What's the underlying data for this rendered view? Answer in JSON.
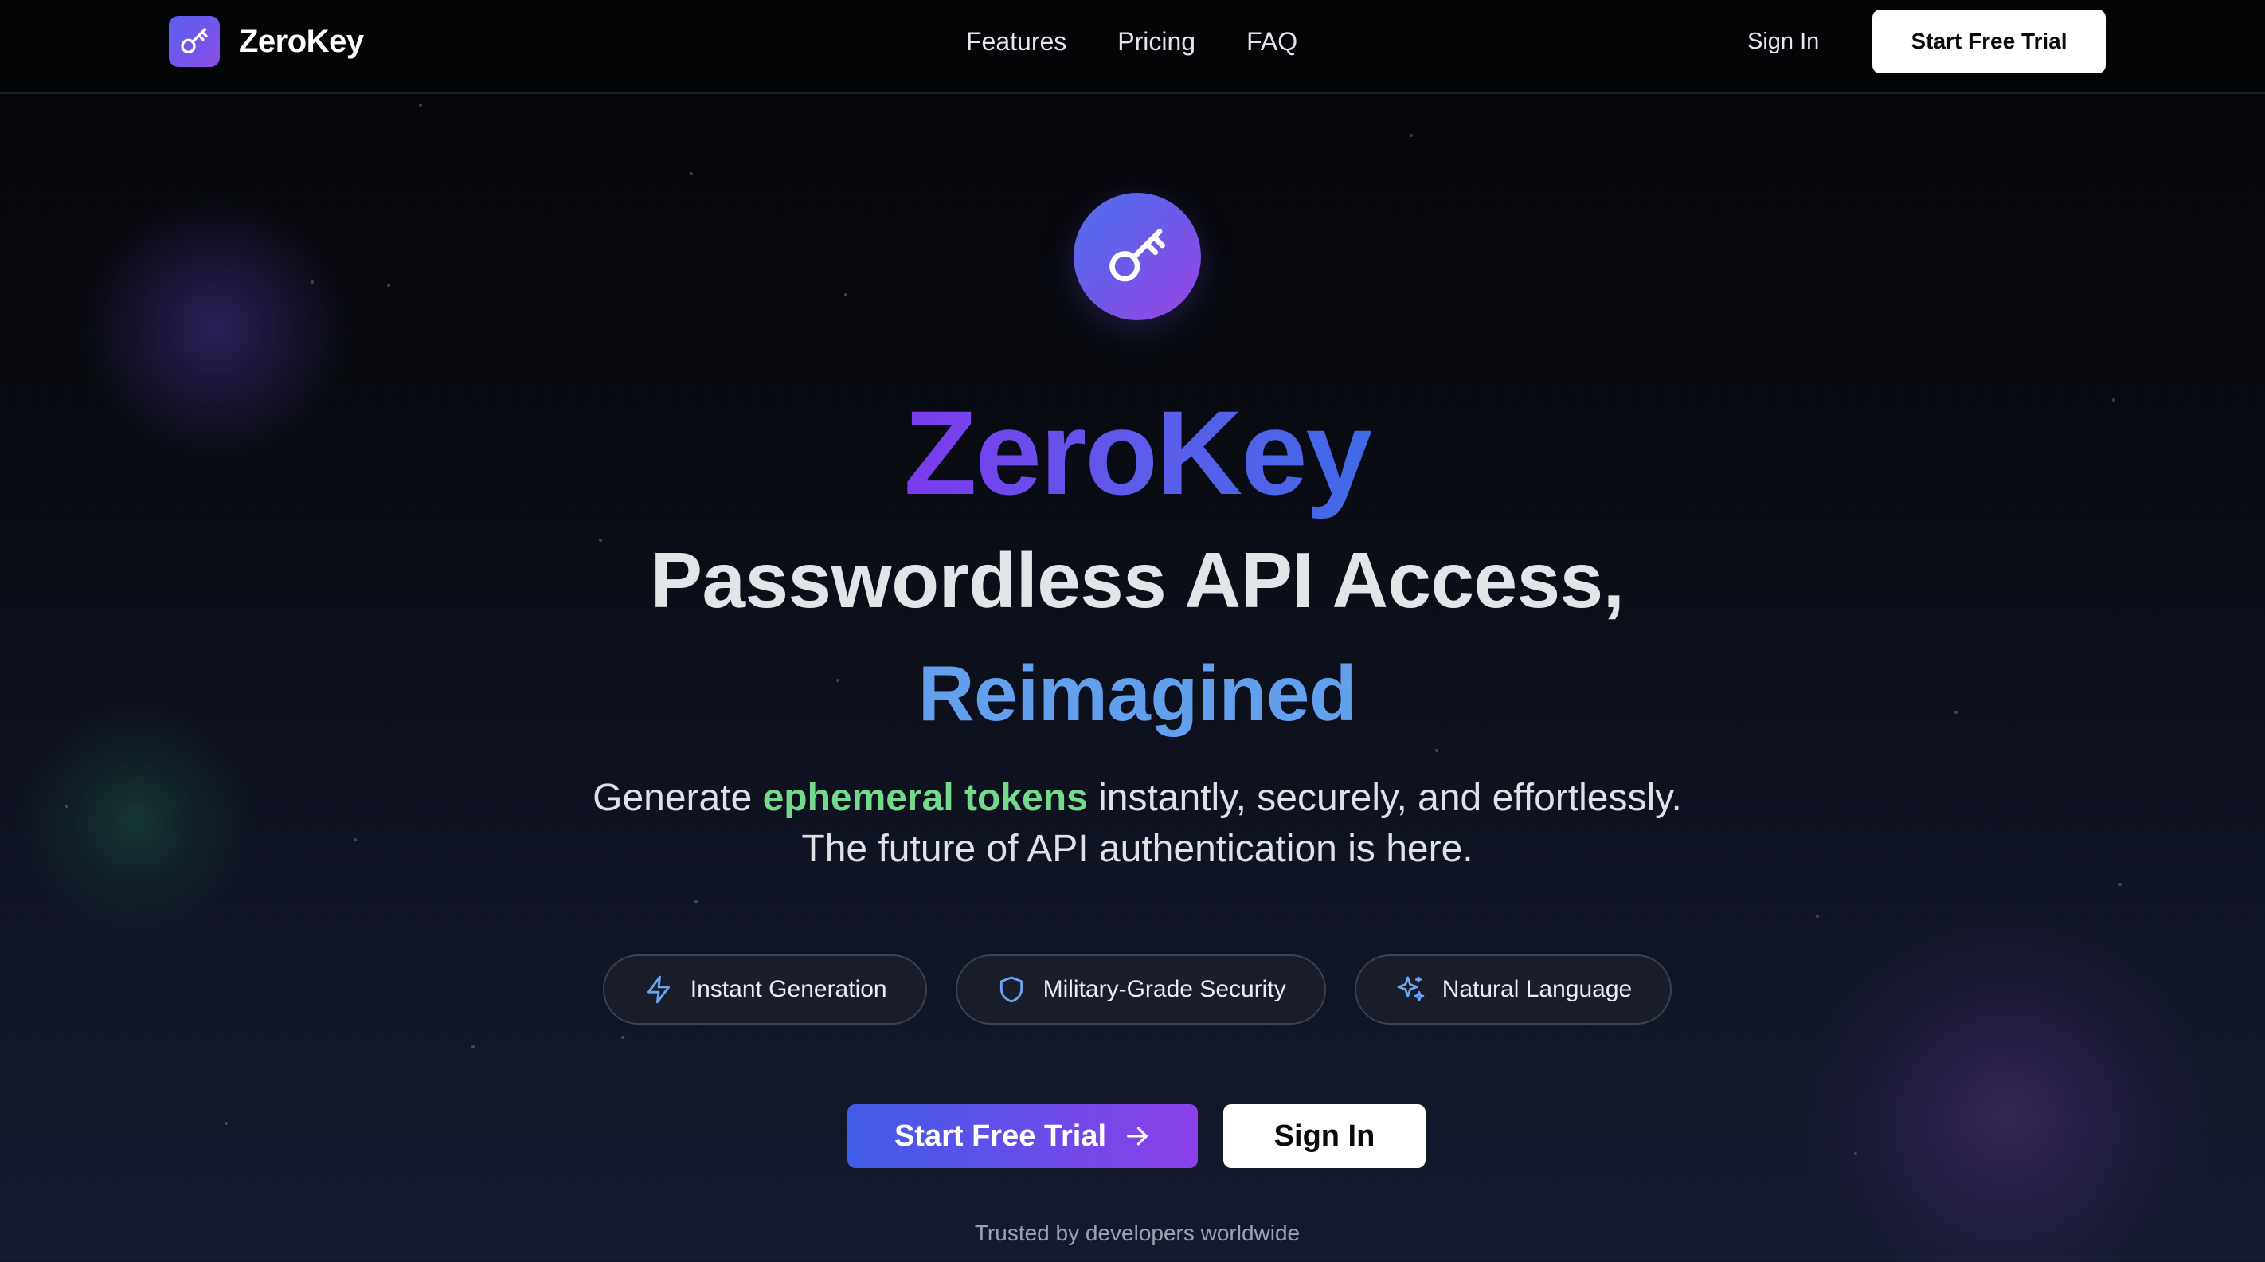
{
  "nav": {
    "brand": "ZeroKey",
    "links": [
      "Features",
      "Pricing",
      "FAQ"
    ],
    "sign_in": "Sign In",
    "start_trial": "Start Free Trial"
  },
  "hero": {
    "title": "ZeroKey",
    "subtitle_line1": "Passwordless API Access,",
    "subtitle_line2": "Reimagined",
    "desc_pre": "Generate ",
    "desc_highlight": "ephemeral tokens",
    "desc_post": " instantly, securely, and effortlessly.",
    "desc_line2": "The future of API authentication is here."
  },
  "features": [
    {
      "label": "Instant Generation",
      "icon": "lightning-icon"
    },
    {
      "label": "Military-Grade Security",
      "icon": "shield-icon"
    },
    {
      "label": "Natural Language",
      "icon": "sparkles-icon"
    }
  ],
  "cta": {
    "primary": "Start Free Trial",
    "secondary": "Sign In"
  },
  "footer_note": "Trusted by developers worldwide",
  "colors": {
    "accent_purple": "#7c3aed",
    "accent_blue": "#62a0ee",
    "highlight_green": "#74d98b",
    "background": "#07090f"
  }
}
